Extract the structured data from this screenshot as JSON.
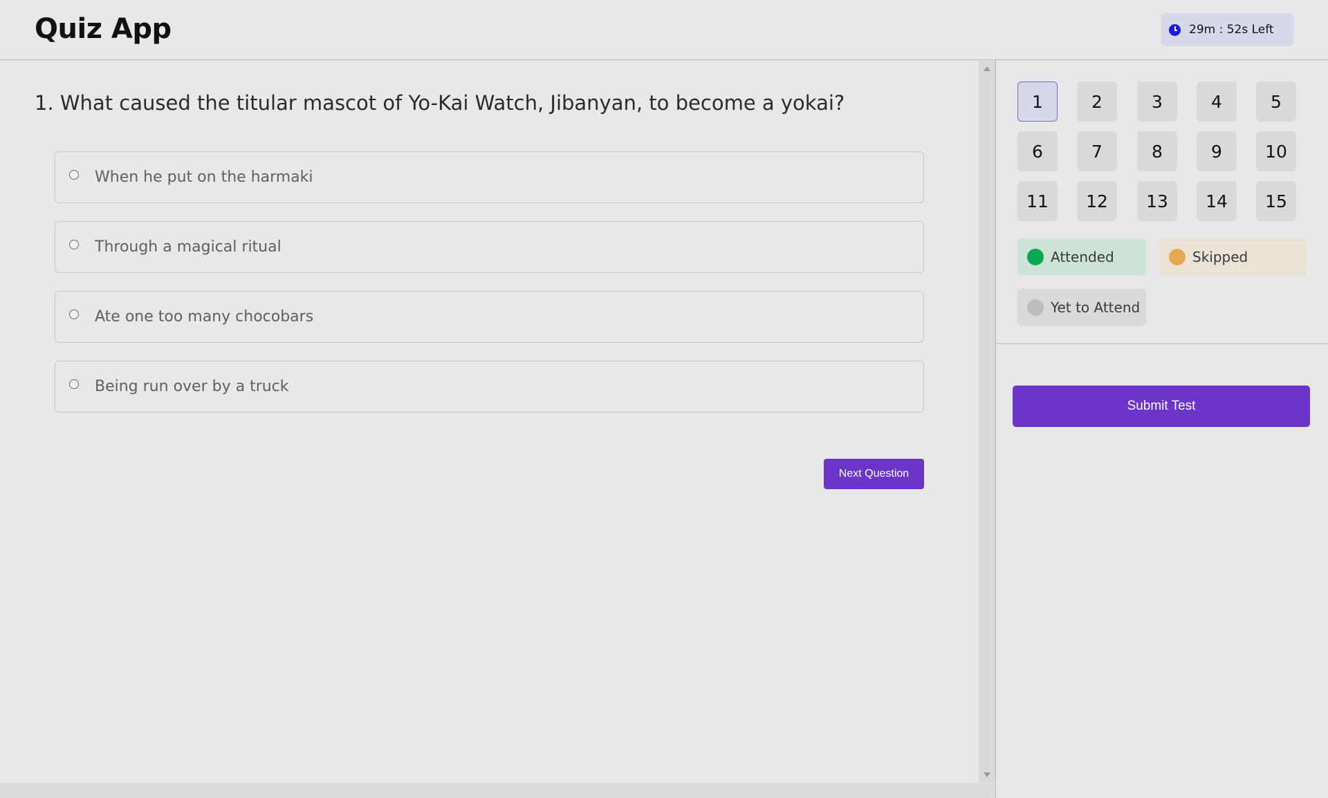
{
  "header": {
    "app_title": "Quiz App",
    "timer": {
      "icon": "clock-icon",
      "text": "29m : 52s Left"
    }
  },
  "question": {
    "text": "1. What caused the titular mascot of Yo-Kai Watch, Jibanyan, to become a yokai?",
    "options": [
      "When he put on the harmaki",
      "Through a magical ritual",
      "Ate one too many chocobars",
      "Being run over by a truck"
    ],
    "next_label": "Next Question"
  },
  "navigator": {
    "numbers": [
      "1",
      "2",
      "3",
      "4",
      "5",
      "6",
      "7",
      "8",
      "9",
      "10",
      "11",
      "12",
      "13",
      "14",
      "15"
    ],
    "current": "1"
  },
  "legend": {
    "attended": {
      "label": "Attended",
      "color": "#0aa84f",
      "bg": "#cde3d7"
    },
    "skipped": {
      "label": "Skipped",
      "color": "#e6a851",
      "bg": "#ece3d7"
    },
    "yet": {
      "label": "Yet to Attend",
      "color": "#bdbdbd",
      "bg": "#dadada"
    }
  },
  "submit_label": "Submit Test",
  "colors": {
    "accent": "#6b35c9",
    "timer_bg": "#d5d9ea"
  }
}
